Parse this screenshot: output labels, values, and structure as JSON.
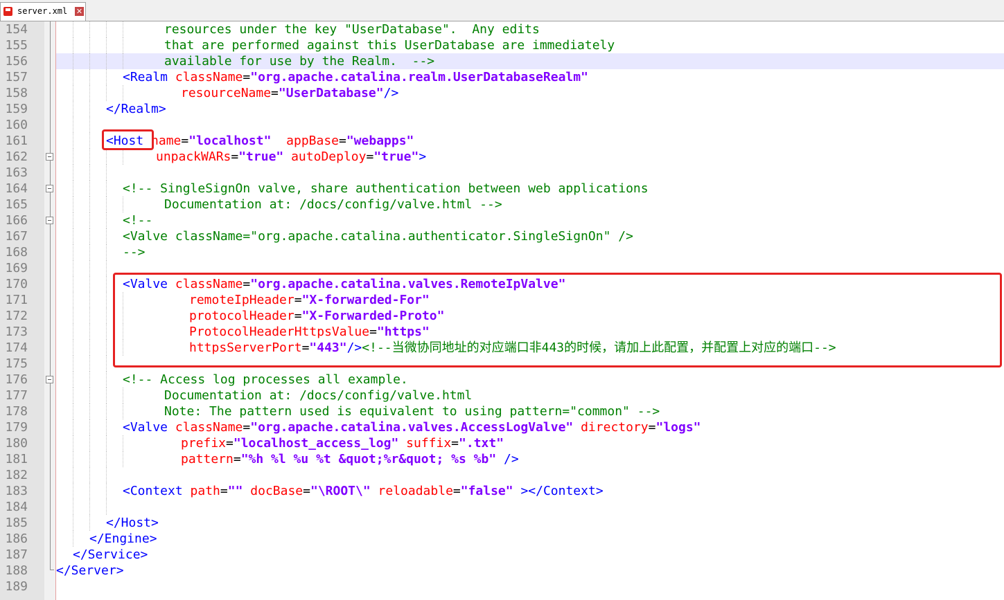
{
  "tab": {
    "label": "server.xml"
  },
  "icons": {
    "save": "save-icon",
    "close": "close-icon"
  },
  "colors": {
    "tag": "#0000ff",
    "attribute": "#ff0000",
    "value": "#8000ff",
    "comment": "#008000",
    "highlight_box": "#e62222",
    "active_line": "#e8e8ff"
  },
  "lines": [
    {
      "n": "154",
      "segs": [
        {
          "c": "c",
          "t": "resources under the key \"UserDatabase\".  Any edits"
        }
      ]
    },
    {
      "n": "155",
      "segs": [
        {
          "c": "c",
          "t": "that are performed against this UserDatabase are immediately"
        }
      ]
    },
    {
      "n": "156",
      "segs": [
        {
          "c": "c",
          "t": "available for use by the Realm.  -->"
        }
      ]
    },
    {
      "n": "157",
      "segs": [
        {
          "c": "t",
          "t": "<Realm "
        },
        {
          "c": "a",
          "t": "className"
        },
        {
          "c": "p",
          "t": "="
        },
        {
          "c": "v",
          "t": "\"org.apache.catalina.realm.UserDatabaseRealm\""
        }
      ]
    },
    {
      "n": "158",
      "segs": [
        {
          "c": "a",
          "t": "resourceName"
        },
        {
          "c": "p",
          "t": "="
        },
        {
          "c": "v",
          "t": "\"UserDatabase\""
        },
        {
          "c": "t",
          "t": "/>"
        }
      ]
    },
    {
      "n": "159",
      "segs": [
        {
          "c": "t",
          "t": "</Realm>"
        }
      ]
    },
    {
      "n": "160",
      "segs": []
    },
    {
      "n": "161",
      "segs": [
        {
          "c": "t",
          "t": "<Host "
        },
        {
          "c": "a",
          "t": "name"
        },
        {
          "c": "p",
          "t": "="
        },
        {
          "c": "v",
          "t": "\"localhost\""
        },
        {
          "c": "p",
          "t": "  "
        },
        {
          "c": "a",
          "t": "appBase"
        },
        {
          "c": "p",
          "t": "="
        },
        {
          "c": "v",
          "t": "\"webapps\""
        }
      ]
    },
    {
      "n": "162",
      "segs": [
        {
          "c": "a",
          "t": "unpackWARs"
        },
        {
          "c": "p",
          "t": "="
        },
        {
          "c": "v",
          "t": "\"true\""
        },
        {
          "c": "p",
          "t": " "
        },
        {
          "c": "a",
          "t": "autoDeploy"
        },
        {
          "c": "p",
          "t": "="
        },
        {
          "c": "v",
          "t": "\"true\""
        },
        {
          "c": "t",
          "t": ">"
        }
      ]
    },
    {
      "n": "163",
      "segs": []
    },
    {
      "n": "164",
      "segs": [
        {
          "c": "c",
          "t": "<!-- SingleSignOn valve, share authentication between web applications"
        }
      ]
    },
    {
      "n": "165",
      "segs": [
        {
          "c": "c",
          "t": "Documentation at: /docs/config/valve.html -->"
        }
      ]
    },
    {
      "n": "166",
      "segs": [
        {
          "c": "c",
          "t": "<!--"
        }
      ]
    },
    {
      "n": "167",
      "segs": [
        {
          "c": "c",
          "t": "<Valve className=\"org.apache.catalina.authenticator.SingleSignOn\" />"
        }
      ]
    },
    {
      "n": "168",
      "segs": [
        {
          "c": "c",
          "t": "-->"
        }
      ]
    },
    {
      "n": "169",
      "segs": []
    },
    {
      "n": "170",
      "segs": [
        {
          "c": "t",
          "t": "<Valve "
        },
        {
          "c": "a",
          "t": "className"
        },
        {
          "c": "p",
          "t": "="
        },
        {
          "c": "v",
          "t": "\"org.apache.catalina.valves.RemoteIpValve\""
        }
      ]
    },
    {
      "n": "171",
      "segs": [
        {
          "c": "a",
          "t": "remoteIpHeader"
        },
        {
          "c": "p",
          "t": "="
        },
        {
          "c": "v",
          "t": "\"X-forwarded-For\""
        }
      ]
    },
    {
      "n": "172",
      "segs": [
        {
          "c": "a",
          "t": "protocolHeader"
        },
        {
          "c": "p",
          "t": "="
        },
        {
          "c": "v",
          "t": "\"X-Forwarded-Proto\""
        }
      ]
    },
    {
      "n": "173",
      "segs": [
        {
          "c": "a",
          "t": "ProtocolHeaderHttpsValue"
        },
        {
          "c": "p",
          "t": "="
        },
        {
          "c": "v",
          "t": "\"https\""
        }
      ]
    },
    {
      "n": "174",
      "segs": [
        {
          "c": "a",
          "t": "httpsServerPort"
        },
        {
          "c": "p",
          "t": "="
        },
        {
          "c": "v",
          "t": "\"443\""
        },
        {
          "c": "t",
          "t": "/>"
        },
        {
          "c": "c",
          "t": "<!--当微协同地址的对应端口非443的时候，请加上此配置，并配置上对应的端口-->"
        }
      ]
    },
    {
      "n": "175",
      "segs": []
    },
    {
      "n": "176",
      "segs": [
        {
          "c": "c",
          "t": "<!-- Access log processes all example."
        }
      ]
    },
    {
      "n": "177",
      "segs": [
        {
          "c": "c",
          "t": "Documentation at: /docs/config/valve.html"
        }
      ]
    },
    {
      "n": "178",
      "segs": [
        {
          "c": "c",
          "t": "Note: The pattern used is equivalent to using pattern=\"common\" -->"
        }
      ]
    },
    {
      "n": "179",
      "segs": [
        {
          "c": "t",
          "t": "<Valve "
        },
        {
          "c": "a",
          "t": "className"
        },
        {
          "c": "p",
          "t": "="
        },
        {
          "c": "v",
          "t": "\"org.apache.catalina.valves.AccessLogValve\""
        },
        {
          "c": "p",
          "t": " "
        },
        {
          "c": "a",
          "t": "directory"
        },
        {
          "c": "p",
          "t": "="
        },
        {
          "c": "v",
          "t": "\"logs\""
        }
      ]
    },
    {
      "n": "180",
      "segs": [
        {
          "c": "a",
          "t": "prefix"
        },
        {
          "c": "p",
          "t": "="
        },
        {
          "c": "v",
          "t": "\"localhost_access_log\""
        },
        {
          "c": "p",
          "t": " "
        },
        {
          "c": "a",
          "t": "suffix"
        },
        {
          "c": "p",
          "t": "="
        },
        {
          "c": "v",
          "t": "\".txt\""
        }
      ]
    },
    {
      "n": "181",
      "segs": [
        {
          "c": "a",
          "t": "pattern"
        },
        {
          "c": "p",
          "t": "="
        },
        {
          "c": "v",
          "t": "\"%h %l %u %t &quot;%r&quot; %s %b\""
        },
        {
          "c": "p",
          "t": " "
        },
        {
          "c": "t",
          "t": "/>"
        }
      ]
    },
    {
      "n": "182",
      "segs": []
    },
    {
      "n": "183",
      "segs": [
        {
          "c": "t",
          "t": "<Context "
        },
        {
          "c": "a",
          "t": "path"
        },
        {
          "c": "p",
          "t": "="
        },
        {
          "c": "v",
          "t": "\"\""
        },
        {
          "c": "p",
          "t": " "
        },
        {
          "c": "a",
          "t": "docBase"
        },
        {
          "c": "p",
          "t": "="
        },
        {
          "c": "v",
          "t": "\"\\ROOT\\\""
        },
        {
          "c": "p",
          "t": " "
        },
        {
          "c": "a",
          "t": "reloadable"
        },
        {
          "c": "p",
          "t": "="
        },
        {
          "c": "v",
          "t": "\"false\""
        },
        {
          "c": "p",
          "t": " "
        },
        {
          "c": "t",
          "t": "></Context>"
        }
      ]
    },
    {
      "n": "184",
      "segs": []
    },
    {
      "n": "185",
      "segs": [
        {
          "c": "t",
          "t": "</Host>"
        }
      ]
    },
    {
      "n": "186",
      "segs": [
        {
          "c": "t",
          "t": "</Engine>"
        }
      ]
    },
    {
      "n": "187",
      "segs": [
        {
          "c": "t",
          "t": "</Service>"
        }
      ]
    },
    {
      "n": "188",
      "segs": [
        {
          "c": "t",
          "t": "</Server>"
        }
      ]
    },
    {
      "n": "189",
      "segs": []
    }
  ]
}
